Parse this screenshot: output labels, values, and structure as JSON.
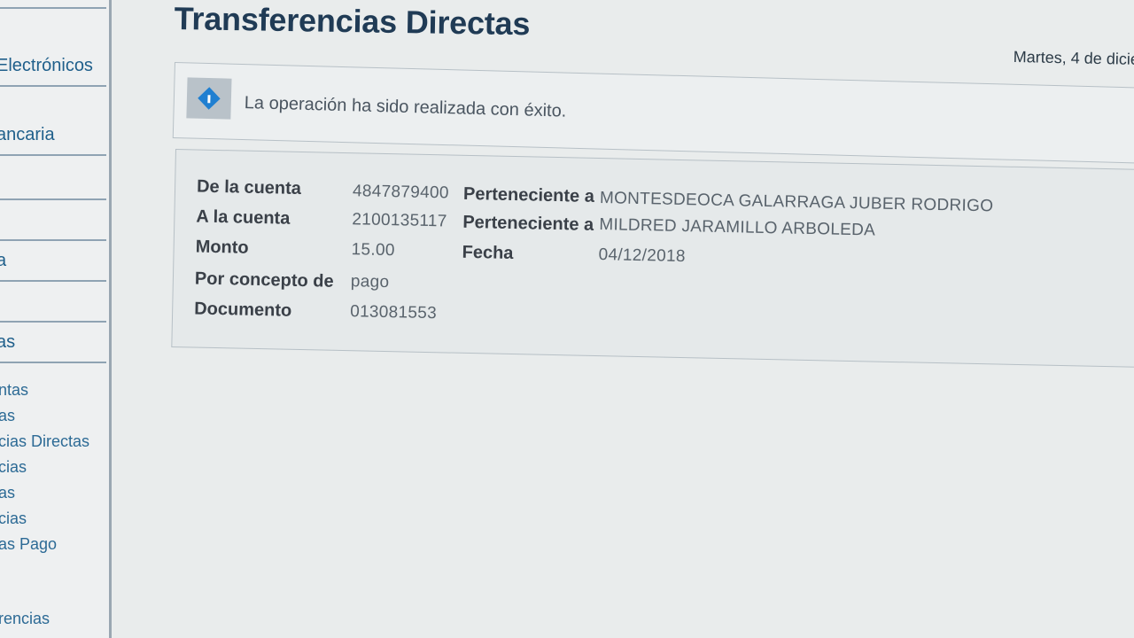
{
  "sidebar": {
    "items": [
      {
        "label": ""
      },
      {
        "label": "Electrónicos"
      },
      {
        "label": "ancaria"
      },
      {
        "label": ""
      },
      {
        "label": ""
      },
      {
        "label": "a"
      },
      {
        "label": ""
      },
      {
        "label": "as"
      }
    ],
    "links": [
      "ntas",
      "as",
      "cias Directas",
      "cias",
      "as",
      "cias",
      "as Pago",
      "rencias"
    ]
  },
  "header": {
    "title": "Transferencias Directas",
    "date": "Martes, 4 de dicie"
  },
  "message": {
    "icon": "info-icon",
    "text": "La operación ha sido realizada con éxito."
  },
  "details": {
    "from_account_label": "De la cuenta",
    "from_account": "4847879400",
    "from_owner_label": "Perteneciente a",
    "from_owner": "MONTESDEOCA GALARRAGA JUBER RODRIGO",
    "to_account_label": "A la cuenta",
    "to_account": "2100135117",
    "to_owner_label": "Perteneciente a",
    "to_owner": "MILDRED JARAMILLO ARBOLEDA",
    "amount_label": "Monto",
    "amount": "15.00",
    "date_label": "Fecha",
    "date": "04/12/2018",
    "concept_label": "Por concepto de",
    "concept": "pago",
    "document_label": "Documento",
    "document": "013081553"
  },
  "colors": {
    "title": "#203b55",
    "sidebar_text": "#1f5f8b",
    "info_icon": "#1f7fd1"
  }
}
